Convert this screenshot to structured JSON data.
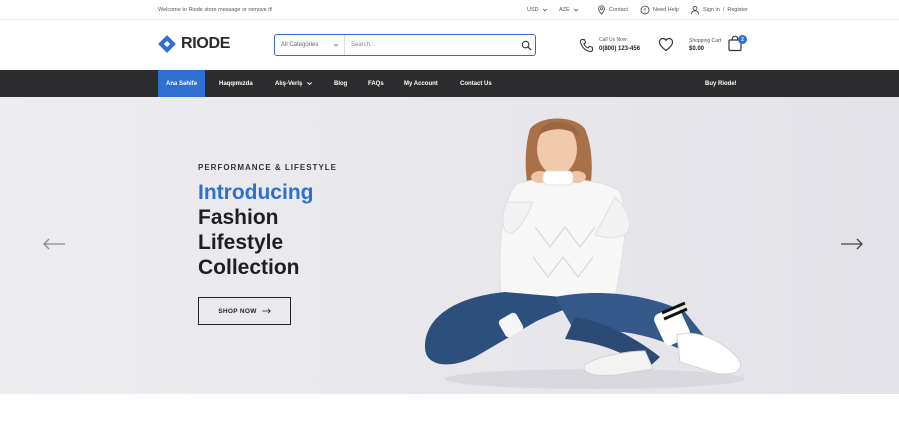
{
  "topbar": {
    "welcome": "Welcome to Riode store message or remove it!",
    "currency": "USD",
    "language": "AZE",
    "contact": "Contact",
    "help": "Need Help",
    "signin": "Sign in",
    "separator": "/",
    "register": "Register"
  },
  "header": {
    "logo": "RIODE",
    "search": {
      "category": "All Categories",
      "placeholder": "Search..."
    },
    "call": {
      "label": "Call Us Now:",
      "number": "0(800) 123-456"
    },
    "cart": {
      "label": "Shopping Cart",
      "amount": "$0.00",
      "count": "2"
    }
  },
  "nav": {
    "items": [
      "Ana Səhifə",
      "Haqqımızda",
      "Alış-Veriş",
      "Blog",
      "FAQs",
      "My Account",
      "Contact Us"
    ],
    "right": "Buy Riode!"
  },
  "hero": {
    "eyebrow": "PERFORMANCE & LIFESTYLE",
    "line1": "Introducing",
    "line2": "Fashion",
    "line3": "Lifestyle",
    "line4": "Collection",
    "button": "SHOP NOW"
  },
  "colors": {
    "accent": "#2f6fd1",
    "nav_bg": "#2c2c2e"
  },
  "icons": [
    "chevron-down-icon",
    "location-icon",
    "help-icon",
    "user-icon",
    "search-icon",
    "phone-icon",
    "heart-icon",
    "bag-icon",
    "arrow-left-icon",
    "arrow-right-icon"
  ]
}
